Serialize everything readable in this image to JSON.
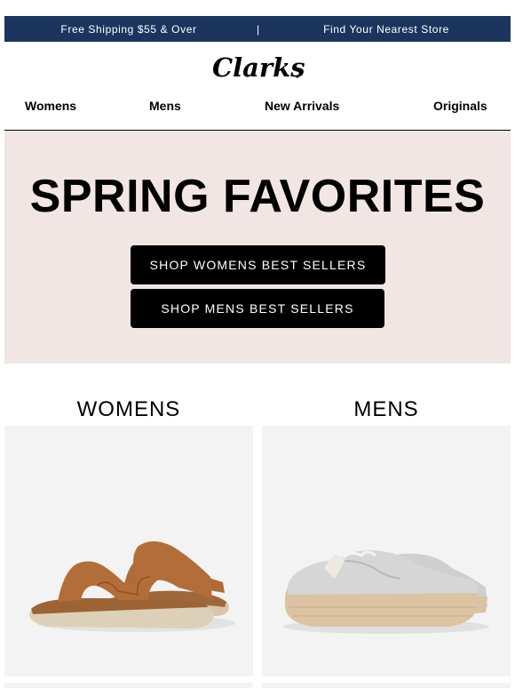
{
  "topbar": {
    "shipping": "Free Shipping $55 & Over",
    "separator": "|",
    "store": "Find Your Nearest Store",
    "background": "#1c355e"
  },
  "brand": {
    "logo_text": "Clarks"
  },
  "nav": {
    "items": [
      "Womens",
      "Mens",
      "New Arrivals",
      "Originals"
    ]
  },
  "hero": {
    "title": "SPRING FAVORITES",
    "background": "#f2e6e5",
    "buttons": [
      "SHOP WOMENS BEST SELLERS",
      "SHOP MENS BEST SELLERS"
    ]
  },
  "sections": [
    {
      "title": "WOMENS",
      "product_image": "tan-leather-slide-sandal"
    },
    {
      "title": "MENS",
      "product_image": "grey-suede-wallabee-shoe"
    }
  ]
}
